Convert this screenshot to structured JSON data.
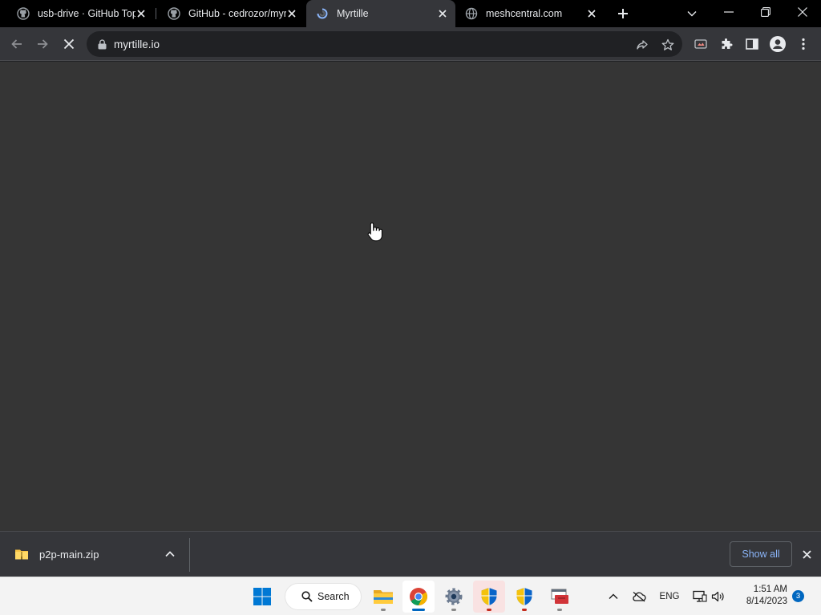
{
  "tabs": [
    {
      "title": "usb-drive · GitHub Topi",
      "favicon": "github-icon",
      "active": false
    },
    {
      "title": "GitHub - cedrozor/myr",
      "favicon": "github-icon",
      "active": false
    },
    {
      "title": "Myrtille",
      "favicon": "myrtille-icon",
      "active": true
    },
    {
      "title": "meshcentral.com",
      "favicon": "globe-icon",
      "active": false
    }
  ],
  "toolbar": {
    "url": "myrtille.io"
  },
  "downloads": {
    "items": [
      {
        "name": "p2p-main.zip",
        "icon": "zip-folder-icon"
      }
    ],
    "show_all_label": "Show all"
  },
  "taskbar": {
    "search_label": "Search",
    "language": "ENG",
    "time": "1:51 AM",
    "date": "8/14/2023",
    "notification_count": "3"
  },
  "colors": {
    "tab_strip": "#000000",
    "toolbar": "#35363a",
    "content_bg": "#353535",
    "link_blue": "#8ab4f8",
    "taskbar": "#f3f3f3"
  }
}
